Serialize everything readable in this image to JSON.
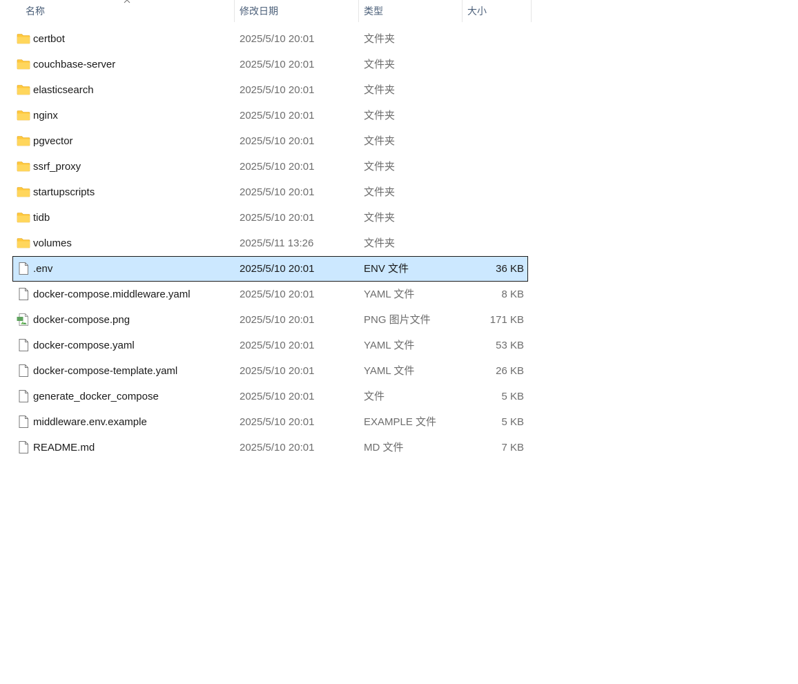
{
  "header": {
    "name_label": "名称",
    "date_label": "修改日期",
    "type_label": "类型",
    "size_label": "大小"
  },
  "files": [
    {
      "name": "certbot",
      "date": "2025/5/10 20:01",
      "type": "文件夹",
      "size": "",
      "icon": "folder-icon"
    },
    {
      "name": "couchbase-server",
      "date": "2025/5/10 20:01",
      "type": "文件夹",
      "size": "",
      "icon": "folder-icon"
    },
    {
      "name": "elasticsearch",
      "date": "2025/5/10 20:01",
      "type": "文件夹",
      "size": "",
      "icon": "folder-icon"
    },
    {
      "name": "nginx",
      "date": "2025/5/10 20:01",
      "type": "文件夹",
      "size": "",
      "icon": "folder-icon"
    },
    {
      "name": "pgvector",
      "date": "2025/5/10 20:01",
      "type": "文件夹",
      "size": "",
      "icon": "folder-icon"
    },
    {
      "name": "ssrf_proxy",
      "date": "2025/5/10 20:01",
      "type": "文件夹",
      "size": "",
      "icon": "folder-icon"
    },
    {
      "name": "startupscripts",
      "date": "2025/5/10 20:01",
      "type": "文件夹",
      "size": "",
      "icon": "folder-icon"
    },
    {
      "name": "tidb",
      "date": "2025/5/10 20:01",
      "type": "文件夹",
      "size": "",
      "icon": "folder-icon"
    },
    {
      "name": "volumes",
      "date": "2025/5/11 13:26",
      "type": "文件夹",
      "size": "",
      "icon": "folder-icon"
    },
    {
      "name": ".env",
      "date": "2025/5/10 20:01",
      "type": "ENV 文件",
      "size": "36 KB",
      "icon": "file-icon",
      "selected": true
    },
    {
      "name": "docker-compose.middleware.yaml",
      "date": "2025/5/10 20:01",
      "type": "YAML 文件",
      "size": "8 KB",
      "icon": "file-icon"
    },
    {
      "name": "docker-compose.png",
      "date": "2025/5/10 20:01",
      "type": "PNG 图片文件",
      "size": "171 KB",
      "icon": "image-file-icon"
    },
    {
      "name": "docker-compose.yaml",
      "date": "2025/5/10 20:01",
      "type": "YAML 文件",
      "size": "53 KB",
      "icon": "file-icon"
    },
    {
      "name": "docker-compose-template.yaml",
      "date": "2025/5/10 20:01",
      "type": "YAML 文件",
      "size": "26 KB",
      "icon": "file-icon"
    },
    {
      "name": "generate_docker_compose",
      "date": "2025/5/10 20:01",
      "type": "文件",
      "size": "5 KB",
      "icon": "file-icon"
    },
    {
      "name": "middleware.env.example",
      "date": "2025/5/10 20:01",
      "type": "EXAMPLE 文件",
      "size": "5 KB",
      "icon": "file-icon"
    },
    {
      "name": "README.md",
      "date": "2025/5/10 20:01",
      "type": "MD 文件",
      "size": "7 KB",
      "icon": "file-icon"
    }
  ],
  "colors": {
    "selection_bg": "#cce8ff",
    "selection_border": "#1b1b1b",
    "folder_yellow": "#ffc83d",
    "header_text": "#4c607a",
    "secondary_text": "#6d6d6d"
  }
}
